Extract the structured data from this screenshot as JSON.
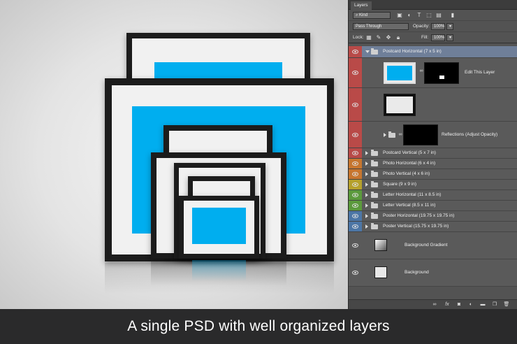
{
  "panel": {
    "tab": "Layers",
    "filter_label": "Kind",
    "blend_mode": "Pass Through",
    "opacity_label": "Opacity:",
    "opacity_value": "100%",
    "lock_label": "Lock:",
    "fill_label": "Fill:",
    "fill_value": "100%"
  },
  "layers": {
    "group_open": "Postcard Horizontal (7 x 5 in)",
    "edit_layer": "Edit This Layer",
    "reflections": "Reflections (Adjust Opacity)",
    "groups": [
      {
        "name": "Postcard Vertical (5 x 7 in)",
        "color": "#b94a48"
      },
      {
        "name": "Photo Horizontal (6 x 4 in)",
        "color": "#c7762f"
      },
      {
        "name": "Photo Vertical (4 x 6 in)",
        "color": "#c7762f"
      },
      {
        "name": "Square (9 x 9 in)",
        "color": "#b6a12c"
      },
      {
        "name": "Letter Horizontal (11 x 8.5 in)",
        "color": "#5b9a3c"
      },
      {
        "name": "Letter Vertical (8.5 x 11 in)",
        "color": "#5b9a3c"
      },
      {
        "name": "Poster Horizontal (19.75 x 19.75 in)",
        "color": "#4c76a6"
      },
      {
        "name": "Poster Vertical (15.75 x 19.75 in)",
        "color": "#4c76a6"
      }
    ],
    "background_gradient": "Background Gradient",
    "background": "Background"
  },
  "colors": {
    "open_group_tag": "#b94a48",
    "photo_blue": "#00aeef",
    "selected_row": "#6f7f99"
  },
  "caption": "A single PSD with well organized layers"
}
